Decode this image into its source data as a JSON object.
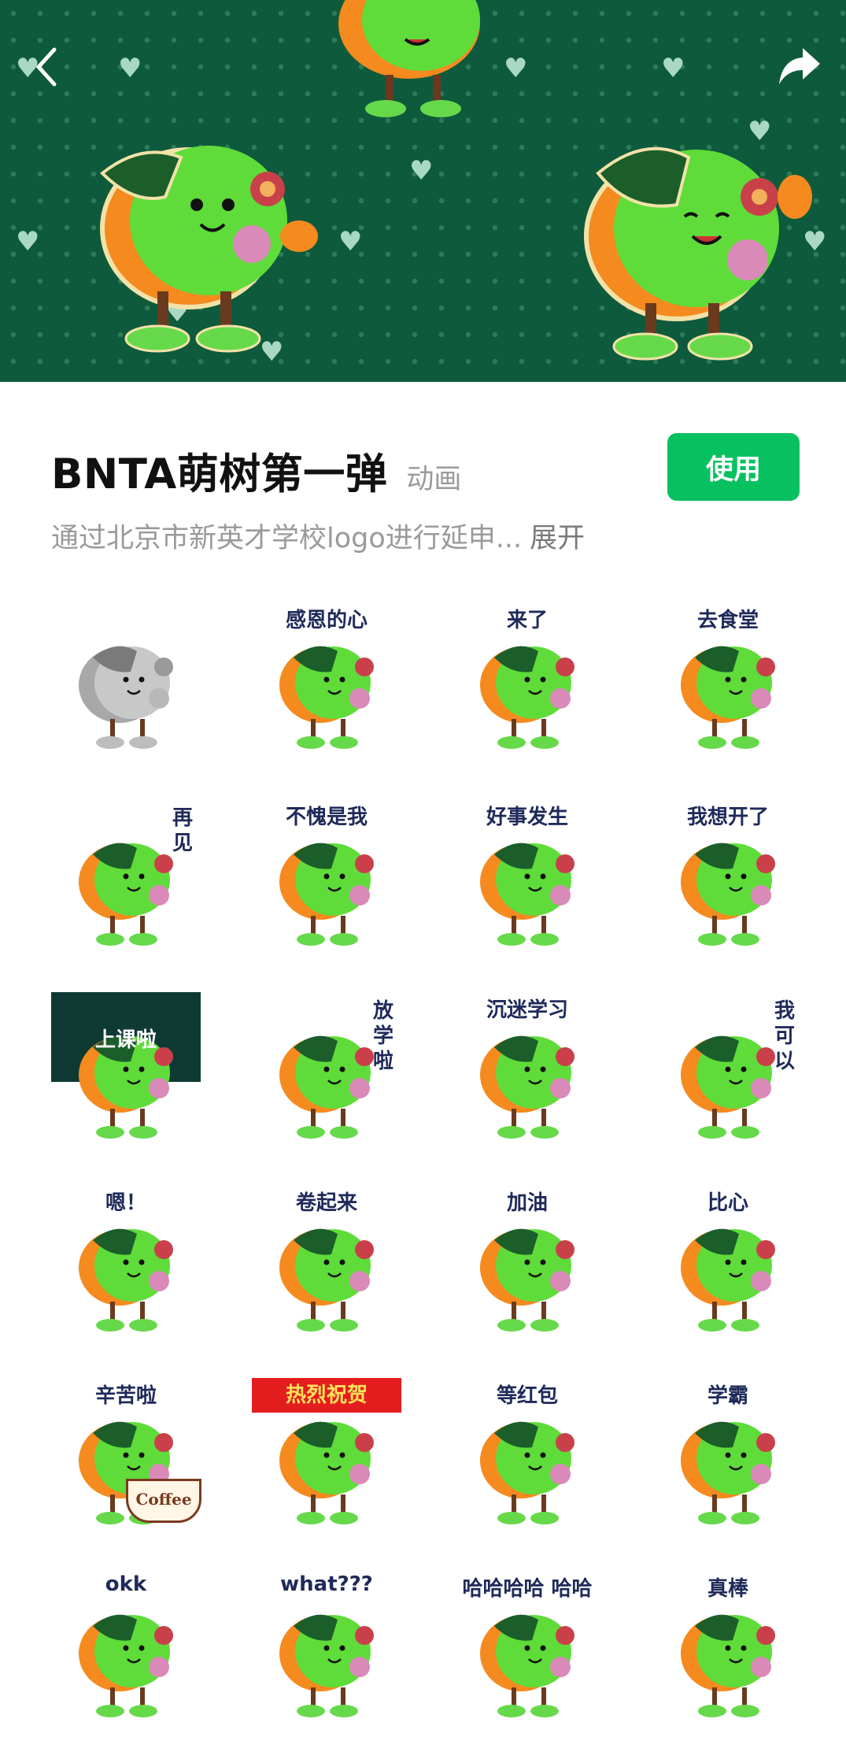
{
  "header": {
    "back_icon": "chevron-left-icon",
    "share_icon": "share-arrow-icon"
  },
  "pack": {
    "title": "BNTA萌树第一弹",
    "type_tag": "动画",
    "use_label": "使用",
    "description": "通过北京市新英才学校logo进行延申...",
    "expand_label": "展开",
    "accent_color": "#07c160"
  },
  "stickers": [
    {
      "caption": ""
    },
    {
      "caption": "感恩的心"
    },
    {
      "caption": "来了"
    },
    {
      "caption": "去食堂"
    },
    {
      "caption": "再见"
    },
    {
      "caption": "不愧是我"
    },
    {
      "caption": "好事发生"
    },
    {
      "caption": "我想开了"
    },
    {
      "caption": "上课啦"
    },
    {
      "caption": "放学啦"
    },
    {
      "caption": "沉迷学习"
    },
    {
      "caption": "我可以"
    },
    {
      "caption": "嗯！"
    },
    {
      "caption": "卷起来"
    },
    {
      "caption": "加油"
    },
    {
      "caption": "比心"
    },
    {
      "caption": "辛苦啦"
    },
    {
      "caption": "热烈祝贺"
    },
    {
      "caption": "等红包"
    },
    {
      "caption": "学霸"
    },
    {
      "caption": "okk"
    },
    {
      "caption": "what???"
    },
    {
      "caption": "哈哈哈哈 哈哈"
    },
    {
      "caption": "真棒"
    }
  ],
  "extra_text": {
    "coffee": "Coffee"
  }
}
